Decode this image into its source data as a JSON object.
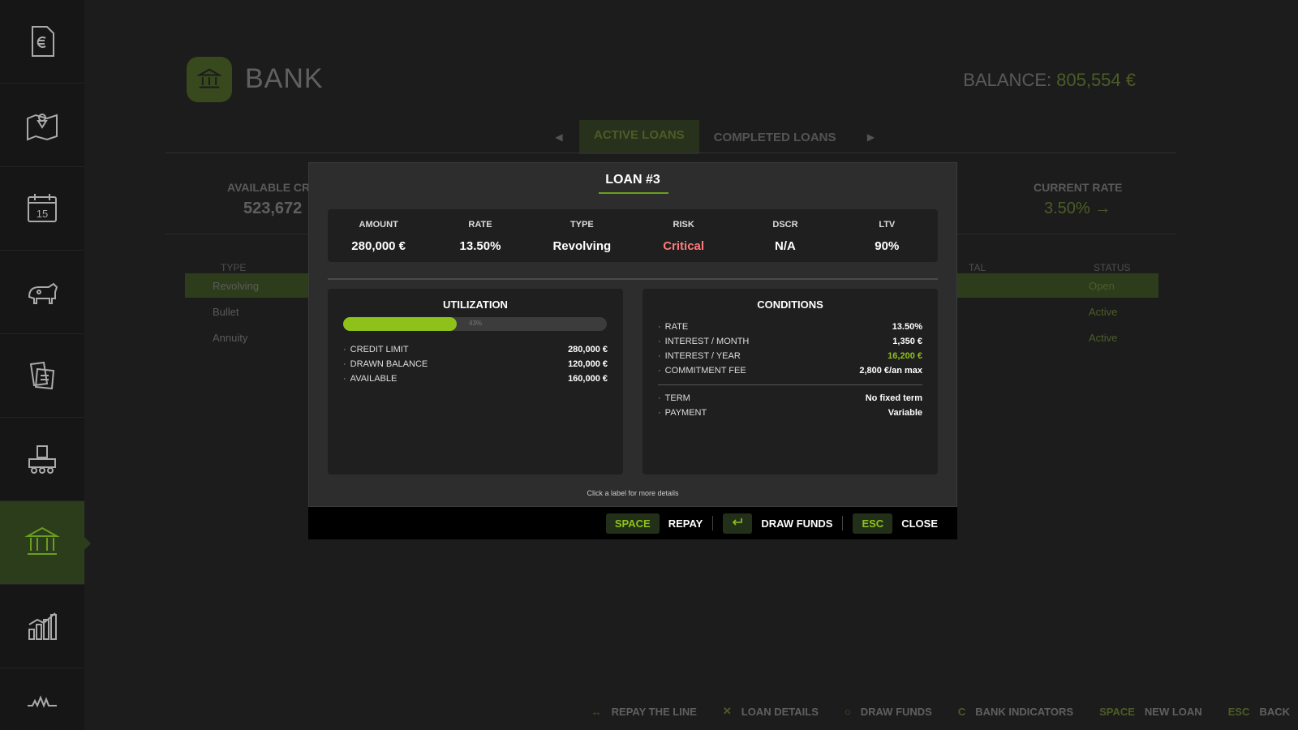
{
  "colors": {
    "accent": "#8ec21a",
    "critical": "#ff7b7b",
    "active_tab": "#3d5a1c"
  },
  "sidebar": {
    "items": [
      {
        "icon": "invoice-euro-icon"
      },
      {
        "icon": "map-pin-icon"
      },
      {
        "icon": "calendar-icon",
        "text": "15"
      },
      {
        "icon": "cow-icon"
      },
      {
        "icon": "documents-icon"
      },
      {
        "icon": "production-icon"
      },
      {
        "icon": "bank-icon",
        "active": true
      },
      {
        "icon": "bar-chart-icon"
      },
      {
        "icon": "activity-icon"
      }
    ]
  },
  "background": {
    "title": "BANK",
    "balance_label": "BALANCE:",
    "balance_value": "805,554 €",
    "tabs": [
      "ACTIVE LOANS",
      "COMPLETED LOANS"
    ],
    "available_label": "AVAILABLE CR",
    "available_value": "523,672",
    "rate_label": "CURRENT RATE",
    "rate_value": "3.50% →",
    "col_type": "TYPE",
    "col_total": "TAL",
    "col_status": "STATUS",
    "rows": [
      {
        "type": "Revolving",
        "status": "Open"
      },
      {
        "type": "Bullet",
        "status": "Active"
      },
      {
        "type": "Annuity",
        "status": "Active"
      }
    ]
  },
  "modal": {
    "title": "LOAN #3",
    "stats": [
      {
        "label": "AMOUNT",
        "value": "280,000 €"
      },
      {
        "label": "RATE",
        "value": "13.50%"
      },
      {
        "label": "TYPE",
        "value": "Revolving"
      },
      {
        "label": "RISK",
        "value": "Critical"
      },
      {
        "label": "DSCR",
        "value": "N/A"
      },
      {
        "label": "LTV",
        "value": "90%"
      }
    ],
    "utilization": {
      "title": "UTILIZATION",
      "percent": 43,
      "percent_label": "43%",
      "rows": [
        {
          "label": "CREDIT LIMIT",
          "value": "280,000 €"
        },
        {
          "label": "DRAWN BALANCE",
          "value": "120,000 €"
        },
        {
          "label": "AVAILABLE",
          "value": "160,000 €"
        }
      ]
    },
    "conditions": {
      "title": "CONDITIONS",
      "rows": [
        {
          "label": "RATE",
          "value": "13.50%"
        },
        {
          "label": "INTEREST / MONTH",
          "value": "1,350 €"
        },
        {
          "label": "INTEREST / YEAR",
          "value": "16,200 €"
        },
        {
          "label": "COMMITMENT FEE",
          "value": "2,800 €/an max"
        }
      ],
      "rows2": [
        {
          "label": "TERM",
          "value": "No fixed term"
        },
        {
          "label": "PAYMENT",
          "value": "Variable"
        }
      ]
    },
    "hint": "Click a label for more details",
    "actions": {
      "repay_key": "SPACE",
      "repay_label": "REPAY",
      "draw_label": "DRAW FUNDS",
      "close_key": "ESC",
      "close_label": "CLOSE"
    }
  },
  "hint_bar": [
    {
      "key": "↔",
      "label": "REPAY THE LINE"
    },
    {
      "key": "✕",
      "label": "LOAN DETAILS"
    },
    {
      "key": "○",
      "label": "DRAW FUNDS"
    },
    {
      "key": "C",
      "label": "BANK INDICATORS"
    },
    {
      "key": "SPACE",
      "label": "NEW LOAN"
    },
    {
      "key": "ESC",
      "label": "BACK"
    }
  ]
}
